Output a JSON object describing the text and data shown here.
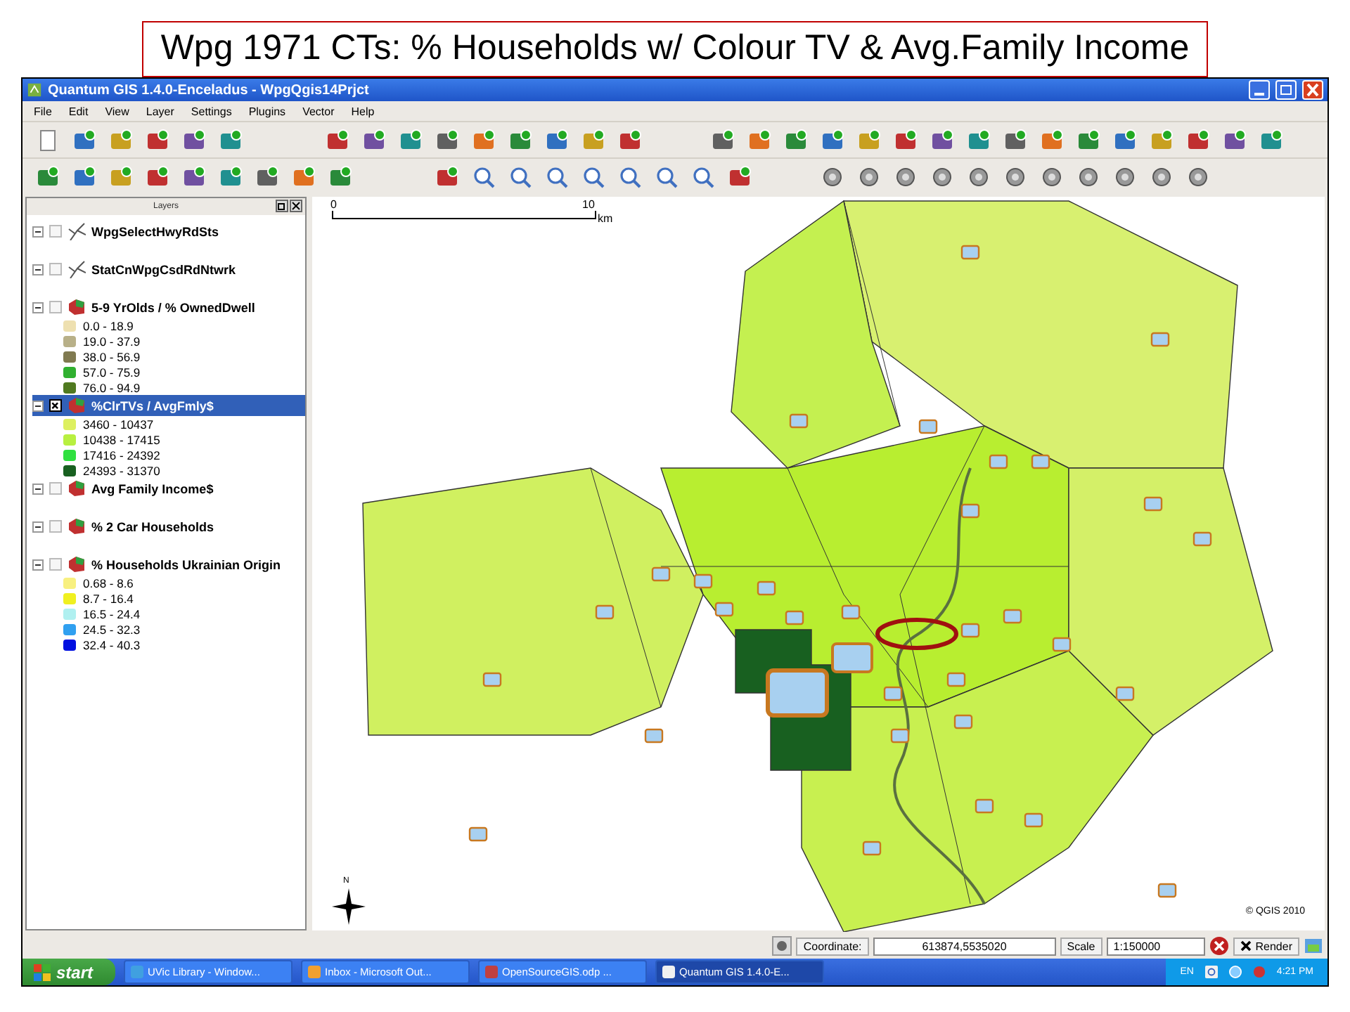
{
  "slide_title": "Wpg 1971 CTs: % Households w/ Colour TV & Avg.Family Income",
  "window": {
    "title": "Quantum GIS 1.4.0-Enceladus - WpgQgis14Prjct"
  },
  "menu": [
    "File",
    "Edit",
    "View",
    "Layer",
    "Settings",
    "Plugins",
    "Vector",
    "Help"
  ],
  "layers_panel": {
    "title": "Layers",
    "layers": [
      {
        "name": "WpgSelectHwyRdSts",
        "kind": "line",
        "checked": false,
        "selected": false,
        "expanded": true
      },
      {
        "name": "StatCnWpgCsdRdNtwrk",
        "kind": "line",
        "checked": false,
        "selected": false,
        "expanded": true
      },
      {
        "name": "5-9 YrOlds / % OwnedDwell",
        "kind": "polygon",
        "checked": false,
        "selected": false,
        "expanded": true,
        "legend": [
          {
            "label": "0.0 - 18.9",
            "color": "#eee0b0"
          },
          {
            "label": "19.0 - 37.9",
            "color": "#b8b088"
          },
          {
            "label": "38.0 - 56.9",
            "color": "#807a50"
          },
          {
            "label": "57.0 - 75.9",
            "color": "#30b030"
          },
          {
            "label": "76.0 - 94.9",
            "color": "#507a20"
          }
        ]
      },
      {
        "name": "%ClrTVs / AvgFmly$",
        "kind": "polygon",
        "checked": true,
        "selected": true,
        "expanded": true,
        "legend": [
          {
            "label": "3460 - 10437",
            "color": "#ddf060"
          },
          {
            "label": "10438 - 17415",
            "color": "#b8f040"
          },
          {
            "label": "17416 - 24392",
            "color": "#30e040"
          },
          {
            "label": "24393 - 31370",
            "color": "#186020"
          }
        ]
      },
      {
        "name": "Avg Family Income$",
        "kind": "polygon",
        "checked": false,
        "selected": false,
        "expanded": true
      },
      {
        "name": "% 2 Car Households",
        "kind": "polygon",
        "checked": false,
        "selected": false,
        "expanded": true
      },
      {
        "name": "% Households Ukrainian Origin",
        "kind": "polygon",
        "checked": false,
        "selected": false,
        "expanded": true,
        "legend": [
          {
            "label": "0.68 - 8.6",
            "color": "#f8f080"
          },
          {
            "label": "8.7 - 16.4",
            "color": "#f0f020"
          },
          {
            "label": "16.5 - 24.4",
            "color": "#b0f0f0"
          },
          {
            "label": "24.5 - 32.3",
            "color": "#30a0f0"
          },
          {
            "label": "32.4 - 40.3",
            "color": "#0010e0"
          }
        ]
      }
    ]
  },
  "map": {
    "scale_start": "0",
    "scale_end": "10",
    "scale_unit": "km",
    "north_label": "N",
    "copyright": "© QGIS 2010"
  },
  "status_bar": {
    "coordinate_label": "Coordinate:",
    "coordinate": "613874,5535020",
    "scale_label": "Scale",
    "scale": "1:150000",
    "render_label": "Render",
    "render": true
  },
  "taskbar": {
    "start": "start",
    "tasks": [
      {
        "label": "UVic Library - Window...",
        "selected": false
      },
      {
        "label": "Inbox - Microsoft Out...",
        "selected": false
      },
      {
        "label": "OpenSourceGIS.odp ...",
        "selected": false
      },
      {
        "label": "Quantum GIS 1.4.0-E...",
        "selected": true
      }
    ],
    "language": "EN",
    "time": "4:21 PM"
  }
}
